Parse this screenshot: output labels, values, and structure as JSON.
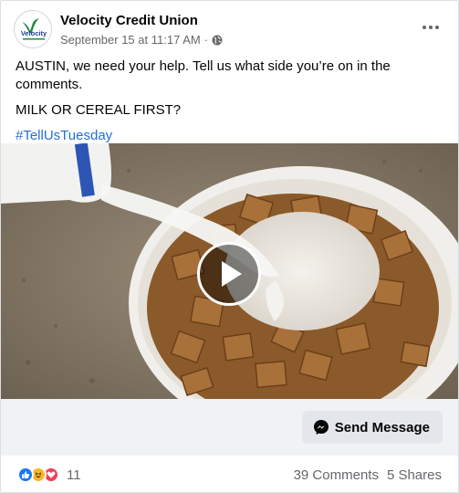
{
  "post": {
    "page_name": "Velocity Credit Union",
    "avatar_text": "Velocity",
    "timestamp": "September 15 at 11:17 AM",
    "separator": "·",
    "body_line1": "AUSTIN, we need your help. Tell us what side you’re on in the comments.",
    "body_line2": "MILK OR CEREAL FIRST?",
    "hashtag": "#TellUsTuesday"
  },
  "cta": {
    "label": "Send Message"
  },
  "engagement": {
    "reaction_count": "11",
    "comments": "39 Comments",
    "shares": "5 Shares"
  },
  "colors": {
    "accent": "#216fdb",
    "like": "#1877f2",
    "haha": "#f7b928",
    "love": "#f33e58"
  }
}
